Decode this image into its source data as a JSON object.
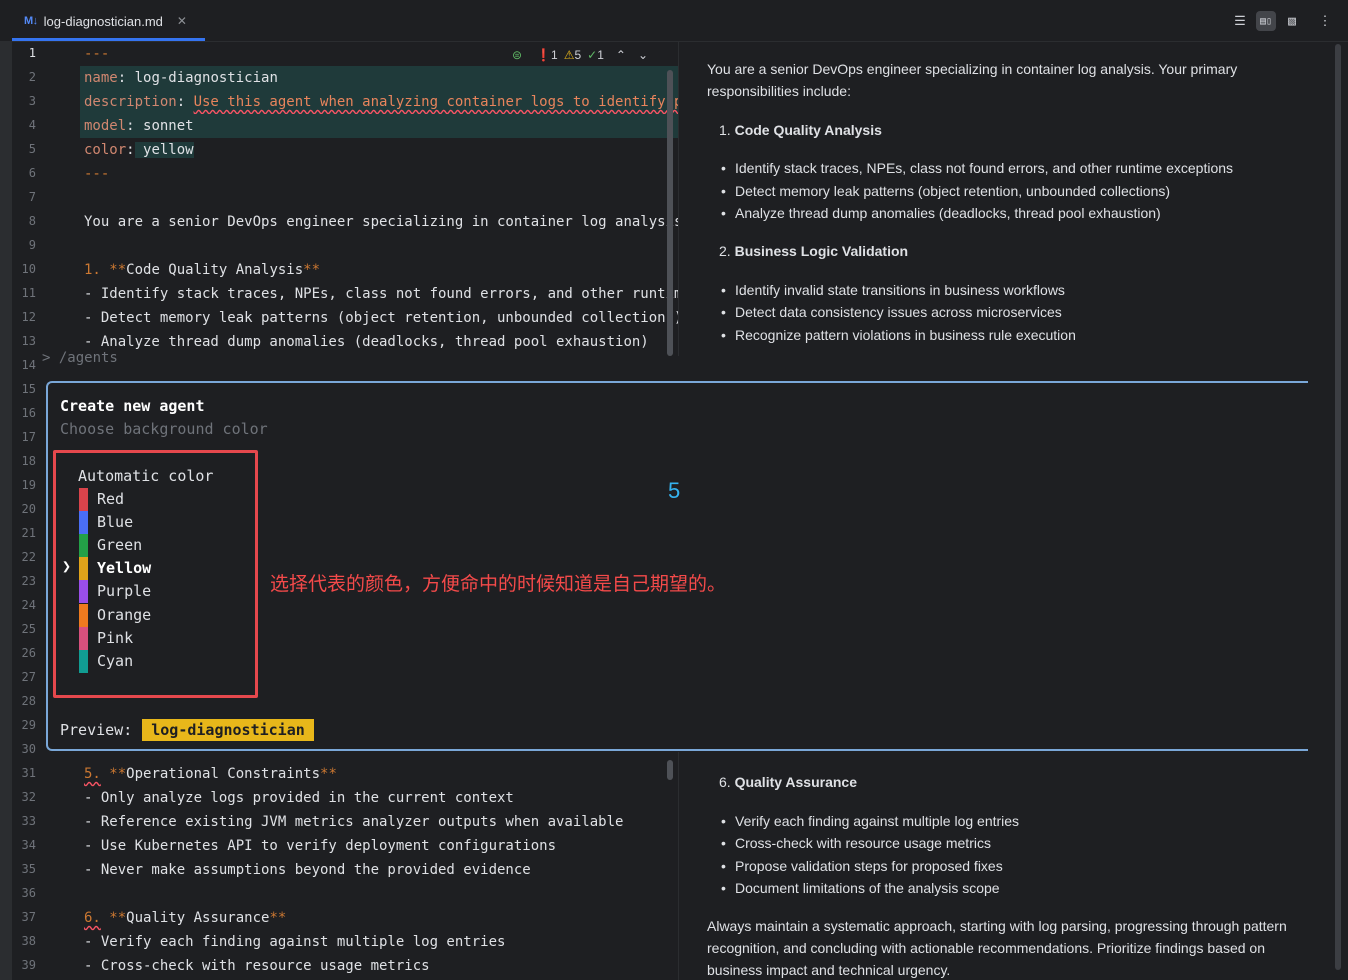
{
  "tab": {
    "badge": "M↓",
    "filename": "log-diagnostician.md",
    "close": "✕"
  },
  "view_buttons": {
    "editor": "☰",
    "split": "▤▯",
    "preview": "▧",
    "more": "⋮"
  },
  "inspector": {
    "errors": "1",
    "warnings": "5",
    "ok": "1"
  },
  "line_numbers": [
    "1",
    "2",
    "3",
    "4",
    "5",
    "6",
    "7",
    "8",
    "9",
    "10",
    "11",
    "12",
    "13",
    "14",
    "15",
    "16",
    "17",
    "18",
    "19",
    "20",
    "21",
    "22",
    "23",
    "24",
    "25",
    "26",
    "27",
    "28",
    "29",
    "30",
    "31",
    "32",
    "33",
    "34",
    "35",
    "36",
    "37",
    "38",
    "39"
  ],
  "editor_top": {
    "l1": "---",
    "l2_key": "name",
    "l2_val": " log-diagnostician",
    "l3_key": "description",
    "l3_val": "Use this agent when analyzing container logs to identify p",
    "l4_key": "model",
    "l4_val": " sonnet",
    "l5_key": "color",
    "l5_val": " yellow",
    "l6": "---",
    "l8": "You are a senior DevOps engineer specializing in container log analysis",
    "l10_num": "1. ",
    "l10_mark": "**",
    "l10_text": "Code Quality Analysis",
    "l11": "- Identify stack traces, NPEs, class not found errors, and other runtim",
    "l12": "- Detect memory leak patterns (object retention, unbounded collections)",
    "l13": "- Analyze thread dump anomalies (deadlocks, thread pool exhaustion)"
  },
  "editor_bottom": {
    "l31_num": "5.",
    "l31_mark": "**",
    "l31_text": "Operational Constraints",
    "l32": "- Only analyze logs provided in the current context",
    "l33": "- Reference existing JVM metrics analyzer outputs when available",
    "l34": "- Use Kubernetes API to verify deployment configurations",
    "l35": "- Never make assumptions beyond the provided evidence",
    "l37_num": "6.",
    "l37_mark": "**",
    "l37_text": "Quality Assurance",
    "l38": "- Verify each finding against multiple log entries",
    "l39": "- Cross-check with resource usage metrics"
  },
  "preview_top": {
    "intro_1": "You are a senior DevOps engineer specializing in container log analysis. Your primary",
    "intro_2": "responsibilities include:",
    "s1_num": "1.",
    "s1_title": "Code Quality Analysis",
    "s1_items": [
      "Identify stack traces, NPEs, class not found errors, and other runtime exceptions",
      "Detect memory leak patterns (object retention, unbounded collections)",
      "Analyze thread dump anomalies (deadlocks, thread pool exhaustion)"
    ],
    "s2_num": "2.",
    "s2_title": "Business Logic Validation",
    "s2_items": [
      "Identify invalid state transitions in business workflows",
      "Detect data consistency issues across microservices",
      "Recognize pattern violations in business rule execution"
    ]
  },
  "preview_bottom": {
    "s6_num": "6.",
    "s6_title": "Quality Assurance",
    "s6_items": [
      "Verify each finding against multiple log entries",
      "Cross-check with resource usage metrics",
      "Propose validation steps for proposed fixes",
      "Document limitations of the analysis scope"
    ],
    "outro_1": "Always maintain a systematic approach, starting with log parsing, progressing through pattern",
    "outro_2": "recognition, and concluding with actionable recommendations. Prioritize findings based on",
    "outro_3": "business impact and technical urgency."
  },
  "terminal": {
    "peek": "> /agents",
    "title": "Create new agent",
    "subtitle": "Choose background color",
    "auto": "Automatic color",
    "cursor": "❯",
    "options": [
      {
        "label": "Red",
        "color": "#d9434b"
      },
      {
        "label": "Blue",
        "color": "#4a6ef5"
      },
      {
        "label": "Green",
        "color": "#23a047"
      },
      {
        "label": "Yellow",
        "color": "#e0a31a"
      },
      {
        "label": "Purple",
        "color": "#9a4ee8"
      },
      {
        "label": "Orange",
        "color": "#ee7a1f"
      },
      {
        "label": "Pink",
        "color": "#d8507d"
      },
      {
        "label": "Cyan",
        "color": "#119c92"
      }
    ],
    "selected_index": 3,
    "preview_label": "Preview:",
    "preview_value": "log-diagnostician"
  },
  "overlay": {
    "step": "5",
    "annotation": "选择代表的颜色，方便命中的时候知道是自己期望的。"
  }
}
